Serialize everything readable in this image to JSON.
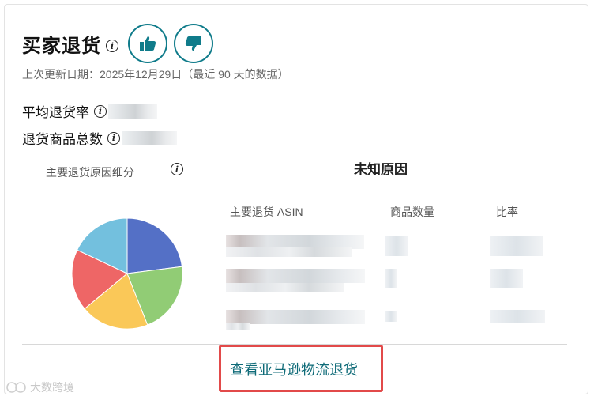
{
  "header": {
    "title": "买家退货",
    "updated_text": "上次更新日期：2025年12月29日（最近 90 天的数据）"
  },
  "stats": {
    "avg_return_rate_label": "平均退货率",
    "total_returned_units_label": "退货商品总数"
  },
  "breakdown": {
    "label": "主要退货原因细分",
    "selected_reason": "未知原因",
    "pie_colors": [
      "#5470c6",
      "#91cc75",
      "#fac858",
      "#ee6666",
      "#73c0de"
    ],
    "pie_fractions": [
      0.23,
      0.21,
      0.2,
      0.18,
      0.18
    ]
  },
  "table": {
    "headers": [
      "主要退货 ASIN",
      "商品数量",
      "比率"
    ]
  },
  "footer": {
    "link_label": "查看亚马逊物流退货"
  },
  "watermark": {
    "text": "大数跨境"
  }
}
